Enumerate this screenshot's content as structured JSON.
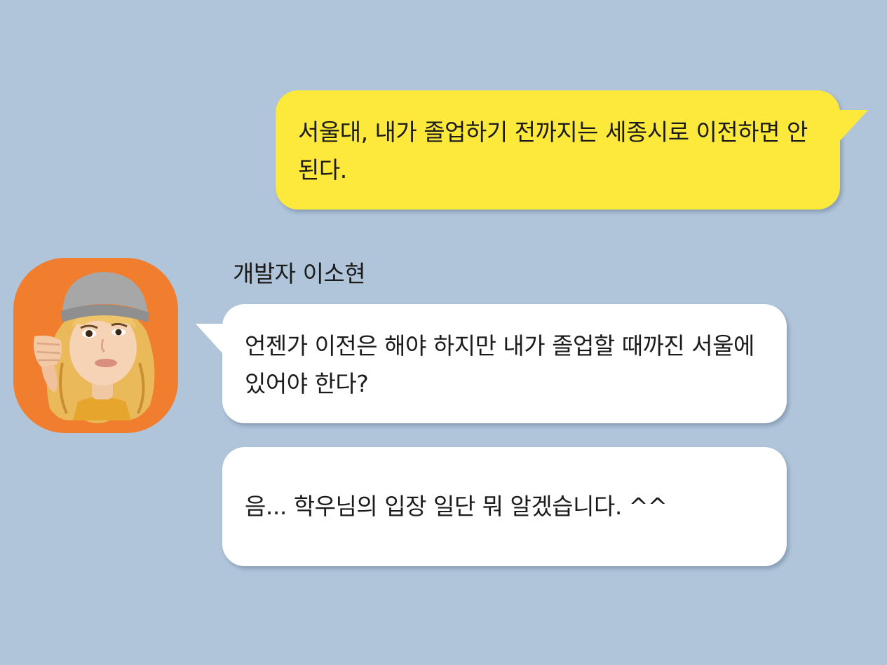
{
  "messages": {
    "outgoing": {
      "text": "서울대, 내가 졸업하기 전까지는 세종시로 이전하면 안 된다.",
      "bubble_color": "#fde93b"
    },
    "sender": {
      "name": "개발자 이소현",
      "avatar_icon": "memoji-thumbs-down-icon",
      "avatar_color": "#f07e2e"
    },
    "incoming": [
      {
        "text": "언젠가 이전은 해야 하지만 내가 졸업할 때까진 서울에 있어야 한다?"
      },
      {
        "text": "음... 학우님의 입장 일단 뭐 알겠습니다. ^^"
      }
    ]
  },
  "theme": {
    "background": "#b0c5da",
    "incoming_bubble": "#ffffff"
  }
}
